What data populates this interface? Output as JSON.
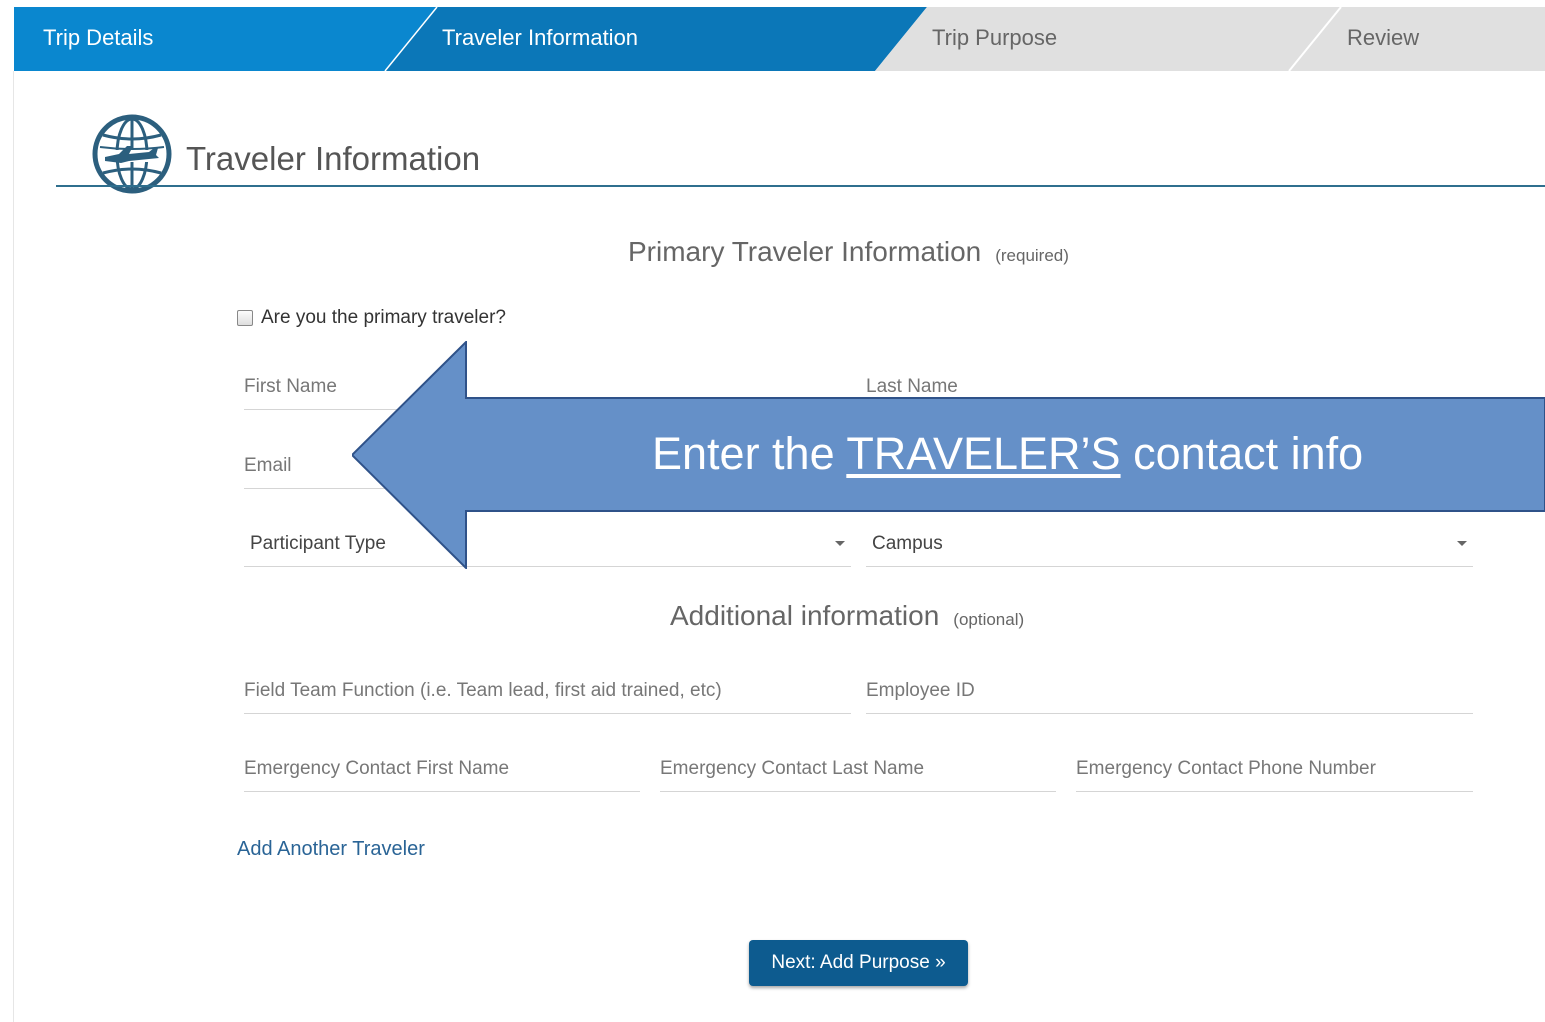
{
  "stepper": {
    "steps": [
      {
        "label": "Trip Details",
        "state": "complete"
      },
      {
        "label": "Traveler Information",
        "state": "active"
      },
      {
        "label": "Trip Purpose",
        "state": "upcoming"
      },
      {
        "label": "Review",
        "state": "upcoming"
      }
    ],
    "colors": {
      "complete": "#0a87cf",
      "active": "#0b77b8",
      "upcoming": "#e0e0e0"
    }
  },
  "header": {
    "title": "Traveler Information",
    "icon": "globe-airplane-icon"
  },
  "primary": {
    "heading": "Primary Traveler Information",
    "heading_note": "(required)",
    "checkbox_label": "Are you the primary traveler?",
    "checkbox_checked": false,
    "first_name_placeholder": "First Name",
    "last_name_placeholder": "Last Name",
    "email_placeholder": "Email",
    "participant_type": "Participant Type",
    "campus": "Campus"
  },
  "additional": {
    "heading": "Additional information",
    "heading_note": "(optional)",
    "field_team_placeholder": "Field Team Function (i.e. Team lead, first aid trained, etc)",
    "employee_id_placeholder": "Employee ID",
    "ec_first_placeholder": "Emergency Contact First Name",
    "ec_last_placeholder": "Emergency Contact Last Name",
    "ec_phone_placeholder": "Emergency Contact Phone Number"
  },
  "actions": {
    "add_traveler": "Add Another Traveler",
    "next": "Next: Add Purpose »"
  },
  "annotation": {
    "text_before": "Enter the ",
    "text_emphasis": "TRAVELER’S",
    "text_after": " contact info",
    "color": "#6590c8"
  }
}
